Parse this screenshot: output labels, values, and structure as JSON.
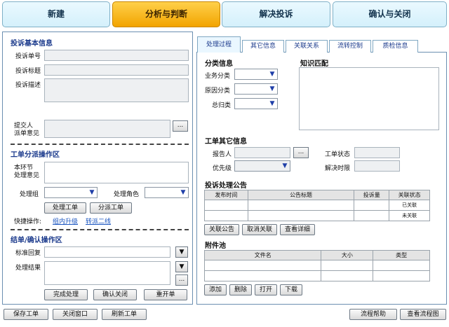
{
  "steps": [
    "新建",
    "分析与判断",
    "解决投诉",
    "确认与关闭"
  ],
  "left": {
    "basic_title": "投诉基本信息",
    "ticket_no_label": "投诉单号",
    "title_label": "投诉标题",
    "desc_label": "投诉描述",
    "submitter_label": "提交人",
    "dispatch_opinion_label": "派单意见",
    "dispatch_title": "工单分派操作区",
    "current_step_label": "本环节",
    "handle_opinion_label": "处理意见",
    "handle_group_label": "处理组",
    "handle_role_label": "处理角色",
    "process_btn": "处理工单",
    "dispatch_btn": "分派工单",
    "quick_label": "快捷操作:",
    "quick_link1": "组内升级",
    "quick_link2": "转派二线",
    "close_title": "结单/确认操作区",
    "std_reply_label": "标准回复",
    "result_label": "处理结果",
    "finish_btn": "完成处理",
    "confirm_close_btn": "确认关闭",
    "reopen_btn": "重开单",
    "dots": "...",
    "arrow": "▼"
  },
  "tabs": [
    "处理过程",
    "其它信息",
    "关联关系",
    "流转控制",
    "质检信息"
  ],
  "right": {
    "classify_title": "分类信息",
    "biz_label": "业务分类",
    "cause_label": "原因分类",
    "total_label": "总归类",
    "knowledge_title": "知识匹配",
    "other_title": "工单其它信息",
    "reporter_label": "报告人",
    "status_label": "工单状态",
    "priority_label": "优先级",
    "deadline_label": "解决时限",
    "notice_title": "投诉处理公告",
    "notice_headers": [
      "发布时间",
      "公告标题",
      "投诉量",
      "关联状态"
    ],
    "notice_rows": [
      [
        "",
        "",
        "",
        "已关联"
      ],
      [
        "",
        "",
        "",
        "未关联"
      ]
    ],
    "link_btn": "关联公告",
    "unlink_btn": "取消关联",
    "detail_btn": "查看详细",
    "attach_title": "附件池",
    "attach_headers": [
      "文件名",
      "大小",
      "类型"
    ],
    "add_btn": "添加",
    "delete_btn": "删除",
    "open_btn": "打开",
    "download_btn": "下载",
    "dots": "...",
    "arrow": "▼"
  },
  "footer": {
    "save": "保存工单",
    "close_window": "关闭窗口",
    "refresh": "刷新工单",
    "help": "流程帮助",
    "view_flow": "查看流程图"
  },
  "colors": {
    "active_step": "#f2a400",
    "step_bg": "#d4f0fb",
    "section_title": "#1b3a8c"
  }
}
